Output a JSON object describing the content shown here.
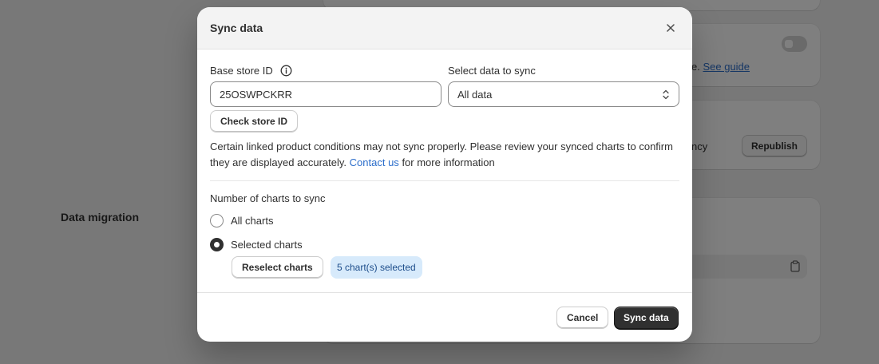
{
  "background": {
    "guide_text": "e.",
    "guide_link": "See guide",
    "republish_prefix": "ncy",
    "republish_label": "Republish",
    "section_title": "Data migration"
  },
  "modal": {
    "title": "Sync data",
    "base_store_label": "Base store ID",
    "base_store_value": "25OSWPCKRR",
    "select_label": "Select data to sync",
    "select_value": "All data",
    "check_button": "Check store ID",
    "notice_text": "Certain linked product conditions may not sync properly. Please review your synced charts to confirm they are displayed accurately.",
    "notice_link": "Contact us",
    "notice_suffix": "for more information",
    "charts_label": "Number of charts to sync",
    "option_all": "All charts",
    "option_selected": "Selected charts",
    "reselect_button": "Reselect charts",
    "selected_badge": "5 chart(s) selected",
    "cancel_button": "Cancel",
    "sync_button": "Sync data"
  },
  "colors": {
    "primary_button": "#303030",
    "link": "#2c6ecb",
    "badge_bg": "#d7eafb"
  }
}
